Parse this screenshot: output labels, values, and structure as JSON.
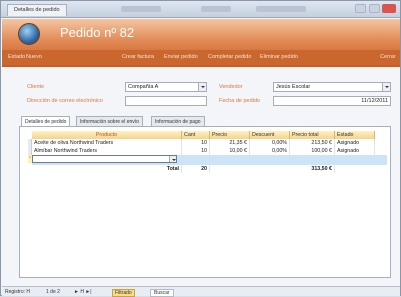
{
  "window": {
    "doc_tab": "Detalles de pedido"
  },
  "header": {
    "title": "Pedido nº 82",
    "nav": [
      "Estado",
      "Nuevo",
      "Crear factura",
      "Enviar pedido",
      "Completar pedido",
      "Eliminar pedido",
      "Cerrar"
    ]
  },
  "form": {
    "cliente_label": "Cliente",
    "cliente_value": "Compañía A",
    "correo_label": "Dirección de correo electrónico",
    "correo_value": "",
    "vendedor_label": "Vendedor",
    "vendedor_value": "Jesús Escolar",
    "fecha_label": "Fecha de pedido",
    "fecha_value": "11/12/2011"
  },
  "tabs": [
    "Detalles de pedido",
    "Información sobre el envío",
    "Información de pago"
  ],
  "grid": {
    "columns": [
      "Producto",
      "Cant",
      "Precio",
      "Descuent",
      "Precio total",
      "Estado"
    ],
    "rows": [
      [
        "Aceite de oliva Northwind Traders",
        "10",
        "21,35 €",
        "0,00%",
        "213,50 €",
        "Asignado"
      ],
      [
        "Almíbar Northwind Traders",
        "10",
        "10,00 €",
        "0,00%",
        "100,00 €",
        "Asignado"
      ]
    ],
    "new_row_marker": "*",
    "total_label": "Total",
    "total_qty": "20",
    "total_amount": "313,50 €"
  },
  "statusbar": {
    "registro": "Registro: H",
    "position": "1 de 2",
    "nav_arrows": "► H ►|",
    "filter": "Filtrado",
    "search": "Buscar"
  },
  "colors": {
    "header_orange": "#e18a55",
    "label_orange": "#d07a45",
    "grid_header": "#f4d48a",
    "new_row": "#cde3f7"
  }
}
